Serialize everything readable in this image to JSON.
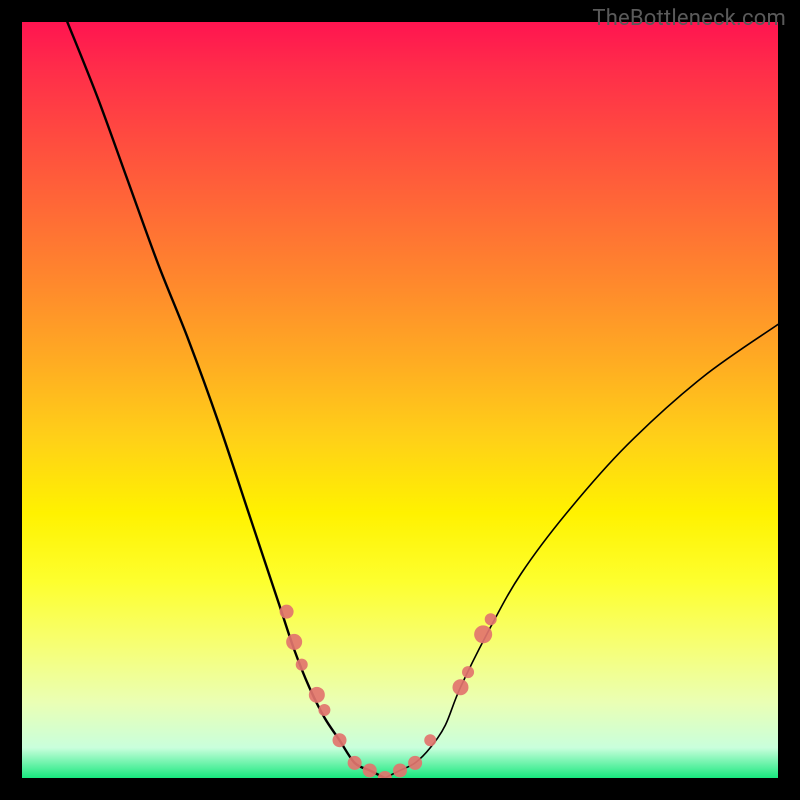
{
  "watermark": "TheBottleneck.com",
  "colors": {
    "frame": "#000000",
    "curve": "#000000",
    "marker_fill": "#e2746e",
    "marker_stroke": "#d95f58",
    "gradient_stops": [
      "#ff1450",
      "#ff2c4a",
      "#ff4a40",
      "#ff6a36",
      "#ff8a2c",
      "#ffac22",
      "#ffd018",
      "#fff200",
      "#fdff2e",
      "#f7ff70",
      "#eaffb4",
      "#c9ffdc",
      "#18e87e"
    ]
  },
  "chart_data": {
    "type": "line",
    "title": "",
    "xlabel": "",
    "ylabel": "",
    "xlim": [
      0,
      100
    ],
    "ylim": [
      0,
      100
    ],
    "note": "Axes are unlabeled; values are normalized 0-100 from pixel positions. Y is inverted visually (0 at bottom). Curve is a V-shape dipping to ~0 near x≈46 then rising.",
    "series": [
      {
        "name": "curve-left",
        "x": [
          6,
          10,
          14,
          18,
          22,
          26,
          30,
          34,
          36,
          38,
          40,
          42,
          44,
          46,
          48
        ],
        "y": [
          100,
          90,
          79,
          68,
          58,
          47,
          35,
          23,
          17,
          12,
          8,
          5,
          2,
          1,
          0
        ]
      },
      {
        "name": "curve-right",
        "x": [
          48,
          50,
          52,
          54,
          56,
          58,
          62,
          66,
          72,
          80,
          90,
          100
        ],
        "y": [
          0,
          1,
          2,
          4,
          7,
          12,
          20,
          27,
          35,
          44,
          53,
          60
        ]
      }
    ],
    "markers": {
      "name": "highlight-points",
      "note": "Pink circular markers clustered near the valley and partway up each arm; radii vary ~5-10px.",
      "points": [
        {
          "x": 35,
          "y": 22,
          "r": 7
        },
        {
          "x": 36,
          "y": 18,
          "r": 8
        },
        {
          "x": 37,
          "y": 15,
          "r": 6
        },
        {
          "x": 39,
          "y": 11,
          "r": 8
        },
        {
          "x": 40,
          "y": 9,
          "r": 6
        },
        {
          "x": 42,
          "y": 5,
          "r": 7
        },
        {
          "x": 44,
          "y": 2,
          "r": 7
        },
        {
          "x": 46,
          "y": 1,
          "r": 7
        },
        {
          "x": 48,
          "y": 0,
          "r": 7
        },
        {
          "x": 50,
          "y": 1,
          "r": 7
        },
        {
          "x": 52,
          "y": 2,
          "r": 7
        },
        {
          "x": 54,
          "y": 5,
          "r": 6
        },
        {
          "x": 58,
          "y": 12,
          "r": 8
        },
        {
          "x": 59,
          "y": 14,
          "r": 6
        },
        {
          "x": 61,
          "y": 19,
          "r": 9
        },
        {
          "x": 62,
          "y": 21,
          "r": 6
        }
      ]
    }
  }
}
